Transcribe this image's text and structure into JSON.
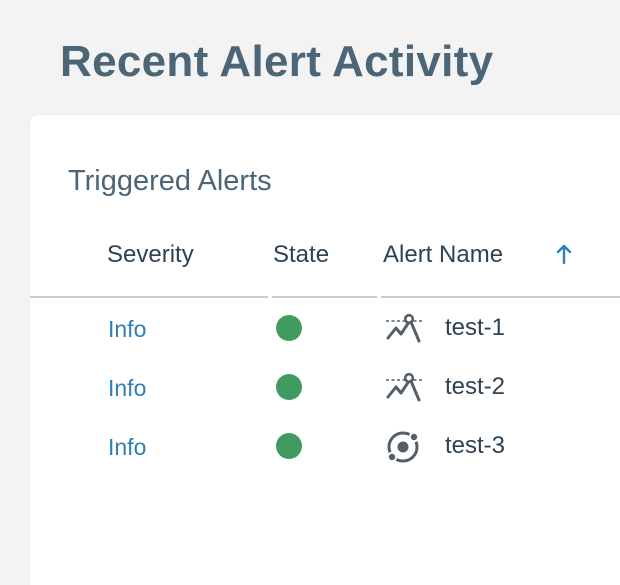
{
  "page": {
    "title": "Recent Alert Activity"
  },
  "panel": {
    "title": "Triggered Alerts",
    "columns": {
      "severity": "Severity",
      "state": "State",
      "alert_name": "Alert Name"
    },
    "sort": {
      "column": "Alert Name",
      "direction": "ascending",
      "icon": "arrow-up-icon"
    },
    "rows": [
      {
        "severity": "Info",
        "state": "active",
        "state_color": "#3f9b5f",
        "type_icon": "metric-threshold-icon",
        "name": "test-1"
      },
      {
        "severity": "Info",
        "state": "active",
        "state_color": "#3f9b5f",
        "type_icon": "metric-threshold-icon",
        "name": "test-2"
      },
      {
        "severity": "Info",
        "state": "active",
        "state_color": "#3f9b5f",
        "type_icon": "orbit-icon",
        "name": "test-3"
      }
    ]
  },
  "colors": {
    "link": "#2e7fb8",
    "title": "#4c6577",
    "text": "#2f4252",
    "state_ok": "#3f9b5f"
  }
}
